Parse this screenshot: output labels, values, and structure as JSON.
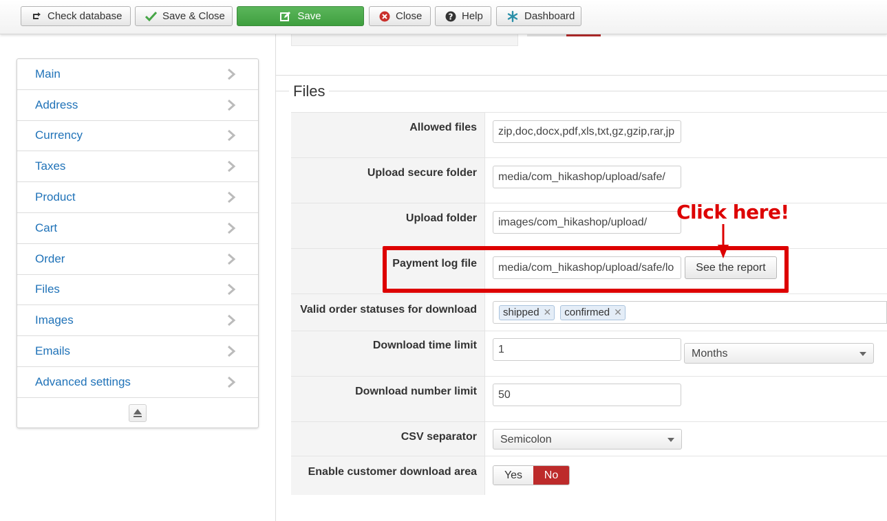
{
  "toolbar": {
    "check_database": "Check database",
    "save_close": "Save & Close",
    "save": "Save",
    "close": "Close",
    "help": "Help",
    "dashboard": "Dashboard"
  },
  "sidebar": {
    "items": [
      {
        "label": "Main"
      },
      {
        "label": "Address"
      },
      {
        "label": "Currency"
      },
      {
        "label": "Taxes"
      },
      {
        "label": "Product"
      },
      {
        "label": "Cart"
      },
      {
        "label": "Order"
      },
      {
        "label": "Files"
      },
      {
        "label": "Images"
      },
      {
        "label": "Emails"
      },
      {
        "label": "Advanced settings"
      }
    ]
  },
  "files": {
    "legend": "Files",
    "allowed_files": {
      "label": "Allowed files",
      "value": "zip,doc,docx,pdf,xls,txt,gz,gzip,rar,jp"
    },
    "upload_secure_folder": {
      "label": "Upload secure folder",
      "value": "media/com_hikashop/upload/safe/"
    },
    "upload_folder": {
      "label": "Upload folder",
      "value": "images/com_hikashop/upload/"
    },
    "payment_log_file": {
      "label": "Payment log file",
      "value": "media/com_hikashop/upload/safe/lo",
      "button": "See the report"
    },
    "valid_order_statuses": {
      "label": "Valid order statuses for download",
      "tags": [
        "shipped",
        "confirmed"
      ]
    },
    "download_time_limit": {
      "label": "Download time limit",
      "value": "1",
      "unit": "Months"
    },
    "download_number_limit": {
      "label": "Download number limit",
      "value": "50"
    },
    "csv_separator": {
      "label": "CSV separator",
      "value": "Semicolon"
    },
    "enable_customer_download_area": {
      "label": "Enable customer download area",
      "yes": "Yes",
      "no": "No",
      "selected": "No"
    }
  },
  "annotation": {
    "text": "Click here!",
    "color": "#dd0000"
  },
  "colors": {
    "link": "#1f72b8",
    "save_green": "#46a546",
    "no_red": "#bd2b2b"
  }
}
